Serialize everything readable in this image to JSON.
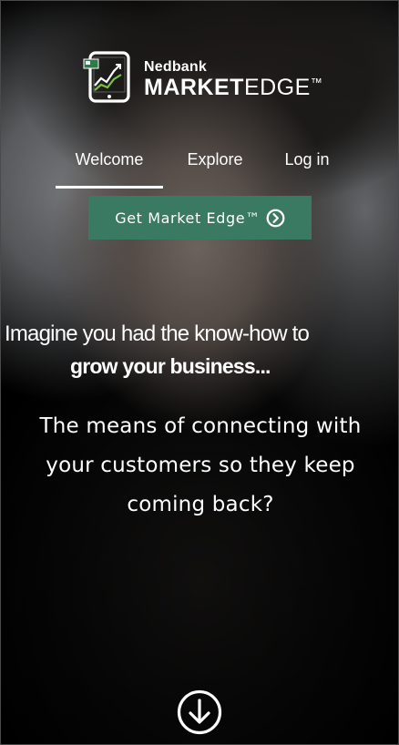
{
  "logo": {
    "brand": "Nedbank",
    "product_bold": "MARKET",
    "product_light": "EDGE",
    "trademark": "™"
  },
  "tabs": [
    {
      "label": "Welcome",
      "active": true
    },
    {
      "label": "Explore",
      "active": false
    },
    {
      "label": "Log in",
      "active": false
    }
  ],
  "cta": {
    "label": "Get Market Edge™",
    "icon": "chevron-right-circle-icon",
    "color": "#3a7a63"
  },
  "hero": {
    "line1": "Imagine you had the know-how to",
    "line2": "grow your business...",
    "sub_lines": [
      "The means of connecting with",
      "your customers so they keep",
      "coming back?"
    ]
  },
  "scroll_button": {
    "icon": "arrow-down-circle-icon"
  }
}
